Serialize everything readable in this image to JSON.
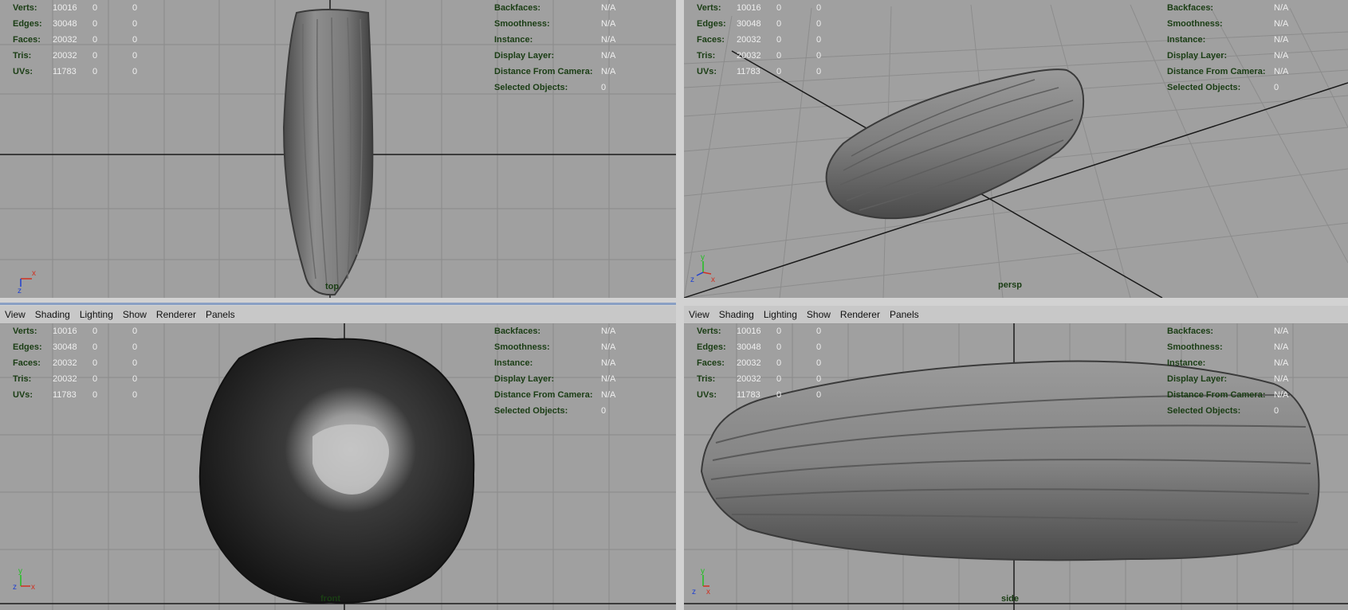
{
  "viewports": [
    {
      "id": "top",
      "menu": null,
      "stats": [
        {
          "label": "Verts:",
          "v1": "10016",
          "v2": "0",
          "v3": "0"
        },
        {
          "label": "Edges:",
          "v1": "30048",
          "v2": "0",
          "v3": "0"
        },
        {
          "label": "Faces:",
          "v1": "20032",
          "v2": "0",
          "v3": "0"
        },
        {
          "label": "Tris:",
          "v1": "20032",
          "v2": "0",
          "v3": "0"
        },
        {
          "label": "UVs:",
          "v1": "11783",
          "v2": "0",
          "v3": "0"
        }
      ],
      "info": [
        {
          "label": "Backfaces:",
          "value": "N/A"
        },
        {
          "label": "Smoothness:",
          "value": "N/A"
        },
        {
          "label": "Instance:",
          "value": "N/A"
        },
        {
          "label": "Display Layer:",
          "value": "N/A"
        },
        {
          "label": "Distance From Camera:",
          "value": "N/A"
        },
        {
          "label": "Selected Objects:",
          "value": "0"
        }
      ],
      "camera": "top",
      "axis": {
        "a": "x",
        "b": "z"
      }
    },
    {
      "id": "persp",
      "menu": null,
      "stats": [
        {
          "label": "Verts:",
          "v1": "10016",
          "v2": "0",
          "v3": "0"
        },
        {
          "label": "Edges:",
          "v1": "30048",
          "v2": "0",
          "v3": "0"
        },
        {
          "label": "Faces:",
          "v1": "20032",
          "v2": "0",
          "v3": "0"
        },
        {
          "label": "Tris:",
          "v1": "20032",
          "v2": "0",
          "v3": "0"
        },
        {
          "label": "UVs:",
          "v1": "11783",
          "v2": "0",
          "v3": "0"
        }
      ],
      "info": [
        {
          "label": "Backfaces:",
          "value": "N/A"
        },
        {
          "label": "Smoothness:",
          "value": "N/A"
        },
        {
          "label": "Instance:",
          "value": "N/A"
        },
        {
          "label": "Display Layer:",
          "value": "N/A"
        },
        {
          "label": "Distance From Camera:",
          "value": "N/A"
        },
        {
          "label": "Selected Objects:",
          "value": "0"
        }
      ],
      "camera": "persp",
      "axis": {
        "a": "y",
        "b": "x",
        "c": "z"
      }
    },
    {
      "id": "front",
      "menu": [
        "View",
        "Shading",
        "Lighting",
        "Show",
        "Renderer",
        "Panels"
      ],
      "stats": [
        {
          "label": "Verts:",
          "v1": "10016",
          "v2": "0",
          "v3": "0"
        },
        {
          "label": "Edges:",
          "v1": "30048",
          "v2": "0",
          "v3": "0"
        },
        {
          "label": "Faces:",
          "v1": "20032",
          "v2": "0",
          "v3": "0"
        },
        {
          "label": "Tris:",
          "v1": "20032",
          "v2": "0",
          "v3": "0"
        },
        {
          "label": "UVs:",
          "v1": "11783",
          "v2": "0",
          "v3": "0"
        }
      ],
      "info": [
        {
          "label": "Backfaces:",
          "value": "N/A"
        },
        {
          "label": "Smoothness:",
          "value": "N/A"
        },
        {
          "label": "Instance:",
          "value": "N/A"
        },
        {
          "label": "Display Layer:",
          "value": "N/A"
        },
        {
          "label": "Distance From Camera:",
          "value": "N/A"
        },
        {
          "label": "Selected Objects:",
          "value": "0"
        }
      ],
      "camera": "front",
      "axis": {
        "a": "y",
        "b": "x",
        "c": "z"
      }
    },
    {
      "id": "side",
      "menu": [
        "View",
        "Shading",
        "Lighting",
        "Show",
        "Renderer",
        "Panels"
      ],
      "stats": [
        {
          "label": "Verts:",
          "v1": "10016",
          "v2": "0",
          "v3": "0"
        },
        {
          "label": "Edges:",
          "v1": "30048",
          "v2": "0",
          "v3": "0"
        },
        {
          "label": "Faces:",
          "v1": "20032",
          "v2": "0",
          "v3": "0"
        },
        {
          "label": "Tris:",
          "v1": "20032",
          "v2": "0",
          "v3": "0"
        },
        {
          "label": "UVs:",
          "v1": "11783",
          "v2": "0",
          "v3": "0"
        }
      ],
      "info": [
        {
          "label": "Backfaces:",
          "value": "N/A"
        },
        {
          "label": "Smoothness:",
          "value": "N/A"
        },
        {
          "label": "Instance:",
          "value": "N/A"
        },
        {
          "label": "Display Layer:",
          "value": "N/A"
        },
        {
          "label": "Distance From Camera:",
          "value": "N/A"
        },
        {
          "label": "Selected Objects:",
          "value": "0"
        }
      ],
      "camera": "side",
      "axis": {
        "a": "y",
        "b": "x",
        "c": "z"
      }
    }
  ],
  "colors": {
    "viewport_bg": "#a0a0a0",
    "hud_label": "#1a3d14",
    "hud_value": "#efefef",
    "axis_x": "#d03020",
    "axis_y": "#20c020",
    "axis_z": "#2040d0"
  }
}
